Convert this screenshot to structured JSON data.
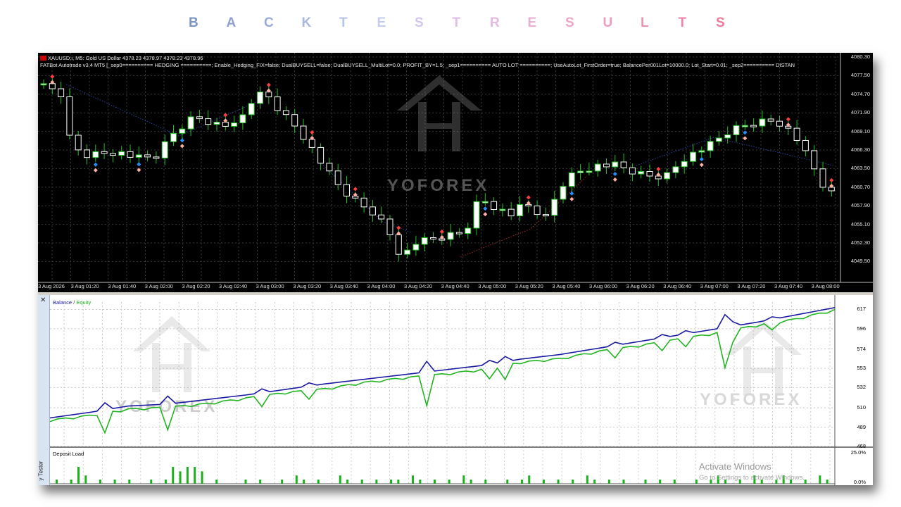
{
  "page_title": {
    "letters": [
      {
        "ch": "B",
        "color": "#7b94c9"
      },
      {
        "ch": "A",
        "color": "#8ea0d4"
      },
      {
        "ch": "C",
        "color": "#9aabdb"
      },
      {
        "ch": "K",
        "color": "#a8b8e3"
      },
      {
        "ch": "T",
        "color": "#b5c6ea"
      },
      {
        "ch": "E",
        "color": "#c3cdf0"
      },
      {
        "ch": "S",
        "color": "#d2c6f0"
      },
      {
        "ch": "T",
        "color": "#dfbde8"
      },
      {
        "ch": "R",
        "color": "#e6b9de"
      },
      {
        "ch": "E",
        "color": "#eab0d4"
      },
      {
        "ch": "S",
        "color": "#eda6c9"
      },
      {
        "ch": "U",
        "color": "#ee9cbf"
      },
      {
        "ch": "L",
        "color": "#ef91b3"
      },
      {
        "ch": "T",
        "color": "#ef86a8"
      },
      {
        "ch": "S",
        "color": "#ee7a9b"
      }
    ]
  },
  "price_chart": {
    "symbol_line": "XAUUSD.i, M5:  Gold US Dollar  4378.23 4378.97 4378.23 4378.96",
    "ea_line": "FATBot Autotrade v3.4 MT5 [_sep0========== HEDGING ==========; Enable_Hedging_FIX=false; DualBUYSELL=false; DualBUYSELL_MultiLot=0.0; PROFIT_BY=1.5; _sep1========== AUTO LOT ==========; UseAutoLot_FirstOrder=true; BalancePer001Lot=10000.0; Lot_Start=0.01; _sep2========== DISTAN",
    "price_ticks": [
      "4080.30",
      "4077.50",
      "4074.70",
      "4071.90",
      "4069.10",
      "4066.30",
      "4063.50",
      "4060.70",
      "4057.90",
      "4055.10",
      "4052.30",
      "4049.50"
    ],
    "time_ticks": [
      "3 Aug 2026",
      "3 Aug 01:20",
      "3 Aug 01:40",
      "3 Aug 02:00",
      "3 Aug 02:20",
      "3 Aug 02:40",
      "3 Aug 03:00",
      "3 Aug 03:20",
      "3 Aug 03:40",
      "3 Aug 04:00",
      "3 Aug 04:20",
      "3 Aug 04:40",
      "3 Aug 05:00",
      "3 Aug 05:20",
      "3 Aug 05:40",
      "3 Aug 06:00",
      "3 Aug 06:20",
      "3 Aug 06:40",
      "3 Aug 07:00",
      "3 Aug 07:20",
      "3 Aug 07:40",
      "3 Aug 08:00"
    ],
    "watermark_text": "YOFOREX",
    "colors": {
      "bull": "#ffffff",
      "bear": "#ffffff",
      "wick": "#22c022",
      "grid": "#3a3a3a",
      "buy_marker": "#1e90ff",
      "sell_marker": "#ff4040"
    }
  },
  "balance_chart": {
    "legend_balance": "Balance",
    "legend_sep": " / ",
    "legend_equity": "Equity",
    "y_ticks": [
      "617",
      "596",
      "574",
      "553",
      "532",
      "510",
      "489",
      "468"
    ],
    "colors": {
      "balance": "#1a1aa0",
      "equity": "#22b422"
    },
    "watermark_text": "YOFOREX"
  },
  "deposit_load": {
    "label": "Deposit Load",
    "max_label": "25.0%",
    "min_label": "0.0%",
    "color": "#1cb01c"
  },
  "side_panel": {
    "close_glyph": "✕",
    "tester_label": "y Tester"
  },
  "os_overlay": {
    "activate_title": "Activate Windows",
    "activate_hint": "Go to Settings to activate Windows."
  },
  "chart_data": [
    {
      "type": "line",
      "title": "",
      "xlabel": "",
      "ylabel": "",
      "ylim": [
        468,
        625
      ],
      "series": [
        {
          "name": "Balance",
          "x": [
            0,
            5,
            10,
            15,
            20,
            25,
            30,
            35,
            40,
            45,
            50,
            55,
            60,
            65,
            70,
            75,
            80,
            85,
            90,
            95,
            100
          ],
          "values": [
            499,
            505,
            512,
            514,
            519,
            524,
            530,
            536,
            541,
            546,
            551,
            556,
            563,
            568,
            575,
            582,
            589,
            596,
            603,
            611,
            619
          ]
        },
        {
          "name": "Equity",
          "x": [
            0,
            5,
            10,
            15,
            20,
            25,
            30,
            35,
            40,
            45,
            50,
            55,
            60,
            65,
            70,
            75,
            80,
            85,
            90,
            95,
            100
          ],
          "values": [
            497,
            502,
            509,
            511,
            515,
            521,
            527,
            531,
            538,
            543,
            547,
            552,
            560,
            564,
            572,
            578,
            585,
            592,
            600,
            607,
            617
          ]
        }
      ]
    },
    {
      "type": "bar",
      "title": "Deposit Load",
      "ylim": [
        0,
        25
      ],
      "values": [
        1,
        0,
        1,
        7,
        2,
        0,
        1,
        0,
        1,
        0,
        1,
        0,
        0,
        1,
        0,
        1,
        7,
        3,
        5,
        7,
        3,
        0,
        1,
        0,
        0,
        0,
        1,
        0,
        1,
        0,
        0,
        1,
        0,
        2,
        1,
        0,
        1,
        0,
        0,
        2,
        1,
        0,
        1,
        0,
        1,
        0,
        1,
        1,
        0,
        2,
        1,
        0,
        1,
        0,
        1,
        0,
        2,
        1,
        0,
        1,
        0,
        0,
        1,
        0,
        1,
        2,
        0,
        1,
        0,
        1,
        0,
        1,
        0,
        2,
        1,
        0,
        1,
        0,
        1,
        0,
        0,
        1,
        0,
        1,
        0,
        1,
        0,
        0,
        1,
        0,
        1,
        2,
        1,
        0,
        1,
        0,
        2,
        1,
        0,
        1,
        2,
        1,
        0,
        1,
        0,
        2,
        1
      ]
    }
  ]
}
